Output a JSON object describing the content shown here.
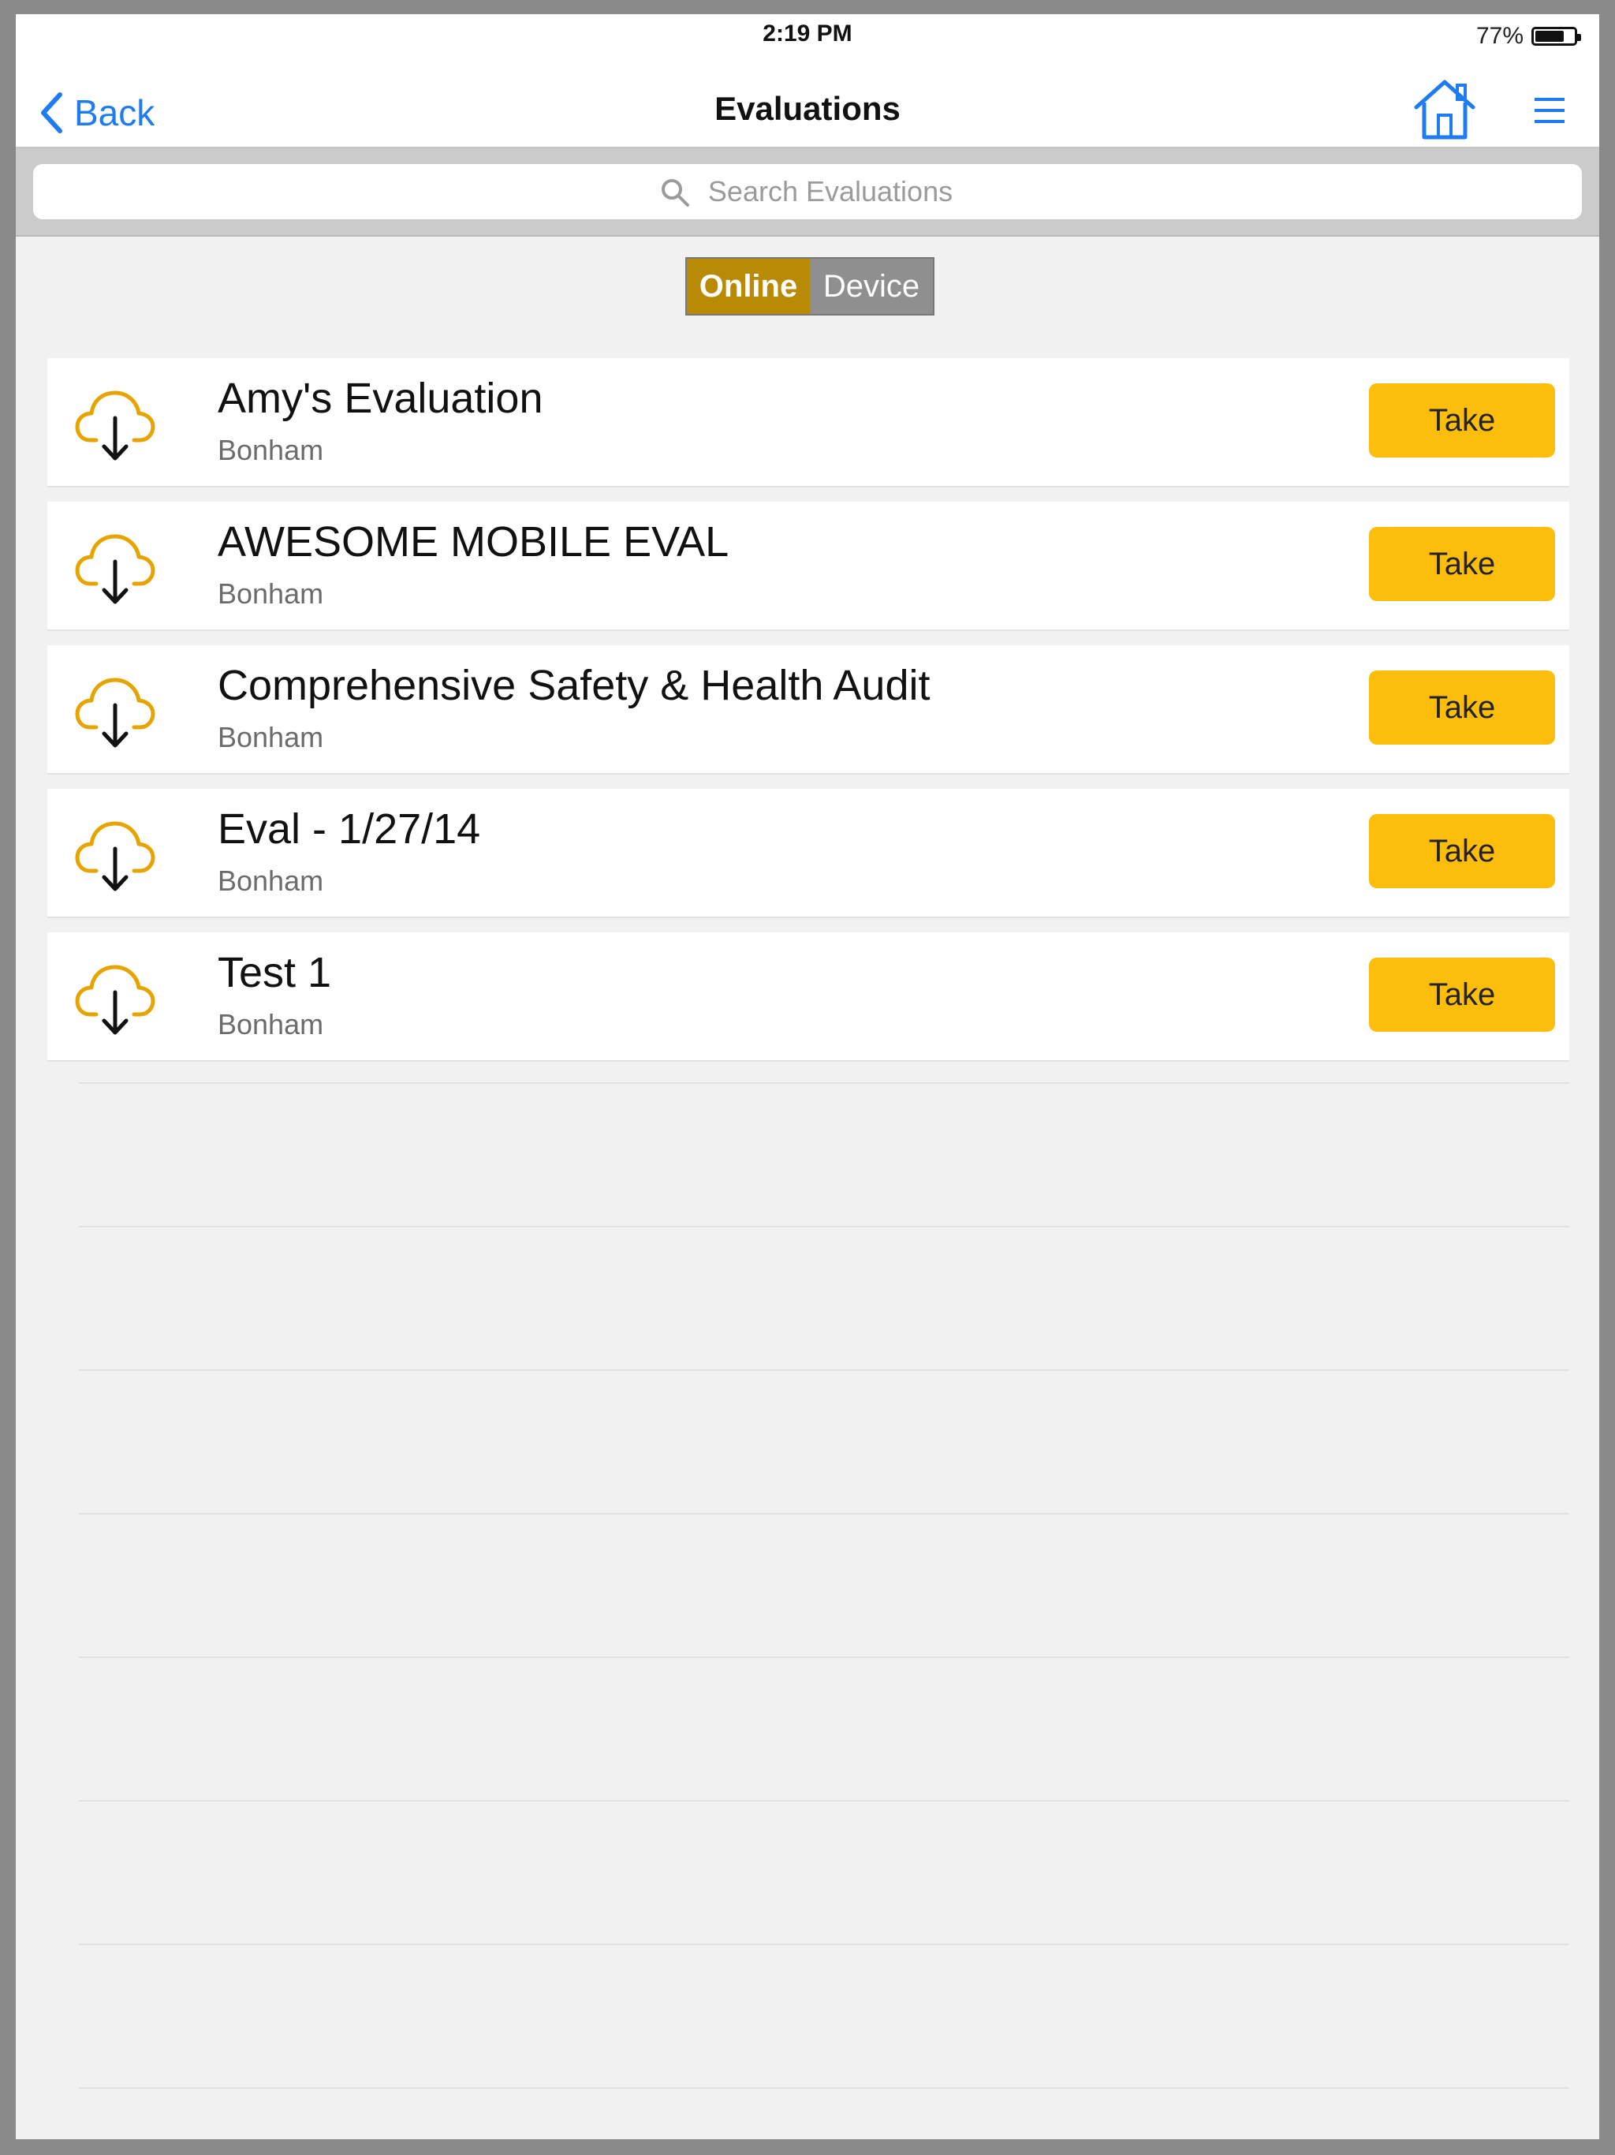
{
  "status": {
    "time": "2:19 PM",
    "battery_percent": "77%",
    "battery_level": 0.77
  },
  "nav": {
    "back_label": "Back",
    "title": "Evaluations",
    "home_icon": "home-icon",
    "menu_icon": "menu-icon"
  },
  "search": {
    "placeholder": "Search Evaluations",
    "value": ""
  },
  "segments": {
    "online": "Online",
    "device": "Device",
    "selected": "Online"
  },
  "accent_colors": {
    "segment_selected": "#b98a06",
    "take_button": "#fdbd0c",
    "link": "#1f7bf0",
    "cloud_icon": "#e6a400"
  },
  "evaluations": [
    {
      "title": "Amy's Evaluation",
      "subtitle": "Bonham",
      "action": "Take"
    },
    {
      "title": "AWESOME MOBILE EVAL",
      "subtitle": "Bonham",
      "action": "Take"
    },
    {
      "title": "Comprehensive Safety & Health Audit",
      "subtitle": "Bonham",
      "action": "Take"
    },
    {
      "title": "Eval - 1/27/14",
      "subtitle": "Bonham",
      "action": "Take"
    },
    {
      "title": "Test 1",
      "subtitle": "Bonham",
      "action": "Take"
    }
  ]
}
